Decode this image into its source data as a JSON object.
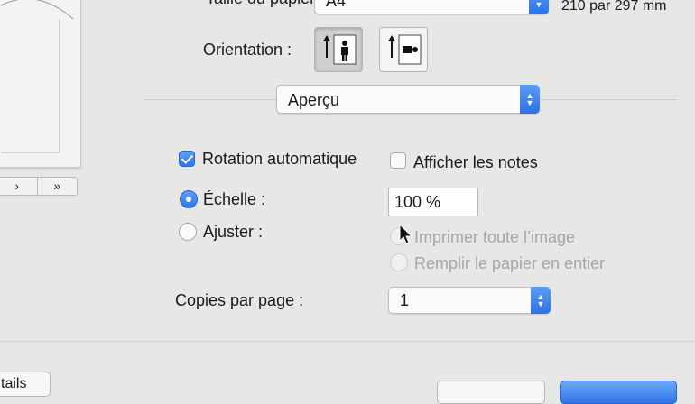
{
  "paper": {
    "label": "Taille du papier :",
    "selected": "A4",
    "dimensions": "210 par 297 mm"
  },
  "orientation": {
    "label": "Orientation :",
    "options": [
      "portrait",
      "landscape"
    ],
    "selected": "portrait"
  },
  "section_popup": {
    "selected": "Aperçu"
  },
  "options": {
    "auto_rotate": {
      "label": "Rotation automatique",
      "checked": true
    },
    "show_notes": {
      "label": "Afficher les notes",
      "checked": false
    }
  },
  "scale": {
    "scale_label": "Échelle :",
    "scale_value": "100 %",
    "scale_selected": true,
    "fit_label": "Ajuster :",
    "fit_selected": false,
    "print_entire_image": "Imprimer toute l’image",
    "fill_paper": "Remplir le papier en entier"
  },
  "copies_per_page": {
    "label": "Copies par page :",
    "value": "1"
  },
  "preview_nav": {
    "next": "›",
    "last": "»"
  },
  "footer": {
    "details_label": "tails"
  },
  "colors": {
    "accent": "#2f74e7",
    "background": "#e7e7e6"
  }
}
